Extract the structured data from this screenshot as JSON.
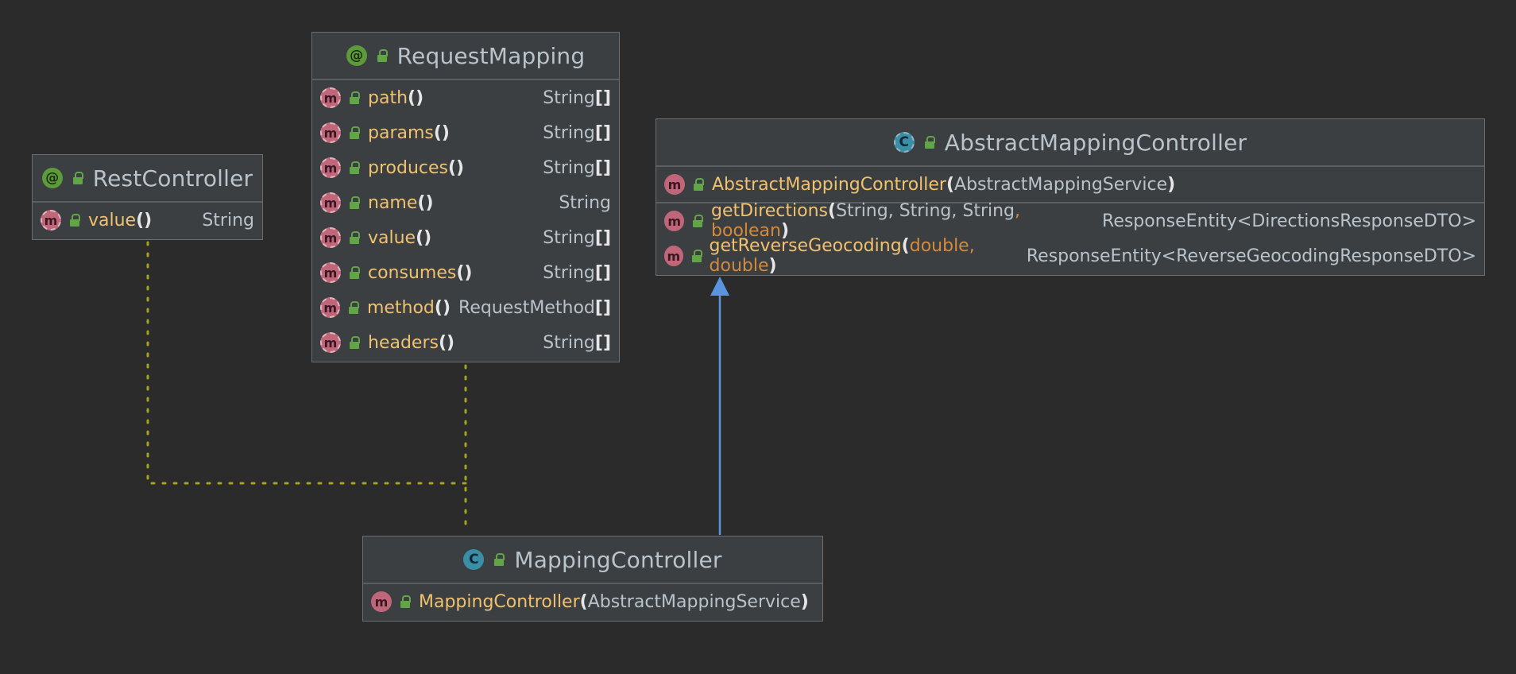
{
  "colors": {
    "background": "#2b2b2b",
    "node_fill": "#3c3f41",
    "method_name": "#f0c26f",
    "primitive_type": "#d48a3c",
    "annotation_badge": "#5c9a3a",
    "class_badge": "#3a8ea8",
    "method_badge": "#c0667a",
    "dotted_edge": "#a6a31f",
    "inheritance_edge": "#5a94e0"
  },
  "rest_controller": {
    "title": "RestController",
    "badge": "@",
    "method_name": "value",
    "method_paren": "()",
    "method_type": "String"
  },
  "request_mapping": {
    "title": "RequestMapping",
    "badge": "@",
    "methods": [
      {
        "name": "path",
        "paren": "()",
        "type": "String",
        "suffix": "[]"
      },
      {
        "name": "params",
        "paren": "()",
        "type": "String",
        "suffix": "[]"
      },
      {
        "name": "produces",
        "paren": "()",
        "type": "String",
        "suffix": "[]"
      },
      {
        "name": "name",
        "paren": "()",
        "type": "String",
        "suffix": ""
      },
      {
        "name": "value",
        "paren": "()",
        "type": "String",
        "suffix": "[]"
      },
      {
        "name": "consumes",
        "paren": "()",
        "type": "String",
        "suffix": "[]"
      },
      {
        "name": "method",
        "paren": "()",
        "type": "RequestMethod",
        "suffix": "[]"
      },
      {
        "name": "headers",
        "paren": "()",
        "type": "String",
        "suffix": "[]"
      }
    ]
  },
  "abstract_controller": {
    "title": "AbstractMappingController",
    "badge": "C",
    "constructor": {
      "name": "AbstractMappingController",
      "open": "(",
      "params": "AbstractMappingService",
      "close": ")"
    },
    "get_directions": {
      "name": "getDirections",
      "open": "(",
      "p1": "String, String, String",
      "comma": ",",
      "p2": "boolean",
      "close": ")",
      "type_main": "ResponseEntity",
      "type_lt": "<",
      "type_arg": "DirectionsResponseDTO",
      "type_gt": ">"
    },
    "get_reverse": {
      "name": "getReverseGeocoding",
      "open": "(",
      "p1": "double",
      "comma": ",",
      "p2": "double",
      "close": ")",
      "type_main": "ResponseEntity",
      "type_lt": "<",
      "type_arg": "ReverseGeocodingResponseDTO",
      "type_gt": ">"
    }
  },
  "mapping_controller": {
    "title": "MappingController",
    "badge": "C",
    "constructor": {
      "name": "MappingController",
      "open": "(",
      "params": "AbstractMappingService",
      "close": ")"
    }
  },
  "method_badge": "m"
}
